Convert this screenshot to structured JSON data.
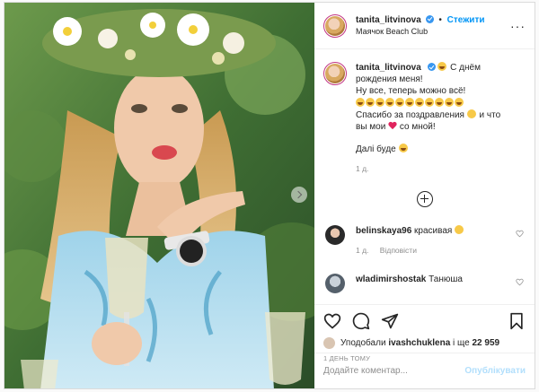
{
  "post": {
    "username": "tanita_litvinova",
    "follow_label": "Стежити",
    "dot": "•",
    "location": "Маячок Beach Club",
    "more_label": "···"
  },
  "caption": {
    "username": "tanita_litvinova",
    "line1": "С днём рождения меня!",
    "line2": "Ну все, теперь можно всё!",
    "line3_text": "Спасибо за поздравления",
    "line3_tail": "и что",
    "line4_start": "вы мои",
    "line4_end": "со мной!",
    "line5": "Далі буде",
    "age": "1 д."
  },
  "comments": [
    {
      "username": "belinskaya96",
      "text": "красивая",
      "age": "1 д.",
      "reply_label": "Відповісти"
    },
    {
      "username": "wladimirshostak",
      "text": "Танюша"
    }
  ],
  "likes": {
    "prefix": "Уподобали",
    "user": "ivashchuklena",
    "suffix": "і ще",
    "count": "22 959"
  },
  "timestamp": "1 день тому",
  "add_comment": {
    "placeholder": "Додайте коментар...",
    "publish_label": "Опублікувати"
  },
  "icons": {
    "heart": "heart-icon",
    "comment": "comment-icon",
    "share": "share-icon",
    "save": "bookmark-icon",
    "verified": "verified-badge-icon",
    "load_more": "plus-circle-icon"
  },
  "colors": {
    "link": "#0095f6",
    "verified": "#3897f0",
    "publish_disabled": "#b2dffc",
    "muted": "#8e8e8e"
  }
}
